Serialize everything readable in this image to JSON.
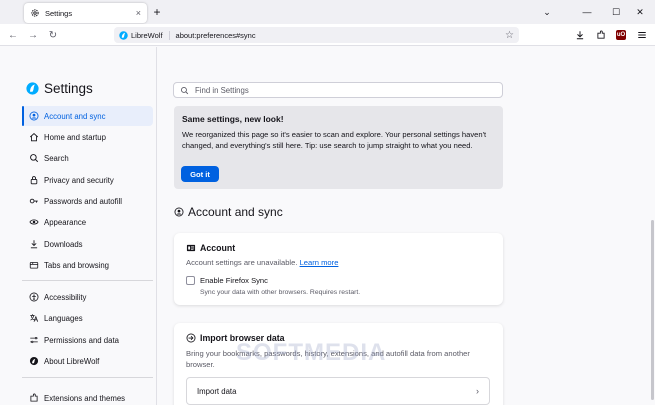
{
  "tab": {
    "title": "Settings",
    "close": "×",
    "new_tab": "+"
  },
  "window": {
    "dropdown": "⌄",
    "minimize": "—",
    "maximize": "☐",
    "close": "✕"
  },
  "nav": {
    "back": "←",
    "forward": "→",
    "reload": "↻",
    "identity_label": "LibreWolf",
    "url": "about:preferences#sync",
    "ublock_label": "uO"
  },
  "sidebar": {
    "title": "Settings",
    "items": [
      {
        "label": "Account and sync",
        "icon": "account-icon"
      },
      {
        "label": "Home and startup",
        "icon": "home-icon"
      },
      {
        "label": "Search",
        "icon": "search-icon"
      },
      {
        "label": "Privacy and security",
        "icon": "lock-icon"
      },
      {
        "label": "Passwords and autofill",
        "icon": "key-icon"
      },
      {
        "label": "Appearance",
        "icon": "eye-icon"
      },
      {
        "label": "Downloads",
        "icon": "download-icon"
      },
      {
        "label": "Tabs and browsing",
        "icon": "tabs-icon"
      },
      {
        "label": "Accessibility",
        "icon": "accessibility-icon"
      },
      {
        "label": "Languages",
        "icon": "languages-icon"
      },
      {
        "label": "Permissions and data",
        "icon": "permissions-icon"
      },
      {
        "label": "About LibreWolf",
        "icon": "info-icon"
      },
      {
        "label": "Extensions and themes",
        "icon": "extensions-icon"
      }
    ]
  },
  "search": {
    "placeholder": "Find in Settings"
  },
  "notice": {
    "title": "Same settings, new look!",
    "body": "We reorganized this page so it's easier to scan and explore. Your personal settings haven't changed, and everything's still here. Tip: use search to jump straight to what you need.",
    "button": "Got it"
  },
  "section": {
    "title": "Account and sync"
  },
  "account_card": {
    "title": "Account",
    "desc": "Account settings are unavailable.",
    "link": "Learn more",
    "sync_label": "Enable Firefox Sync",
    "sync_desc": "Sync your data with other browsers. Requires restart."
  },
  "import_card": {
    "title": "Import browser data",
    "desc": "Bring your bookmarks, passwords, history, extensions, and autofill data from another browser.",
    "row_label": "Import data",
    "chevron": "›"
  },
  "watermark": "SOFTMEDIA",
  "colors": {
    "accent": "#0061e0",
    "active_bg": "#e8eefb",
    "notice_bg": "#e6e6ea"
  }
}
